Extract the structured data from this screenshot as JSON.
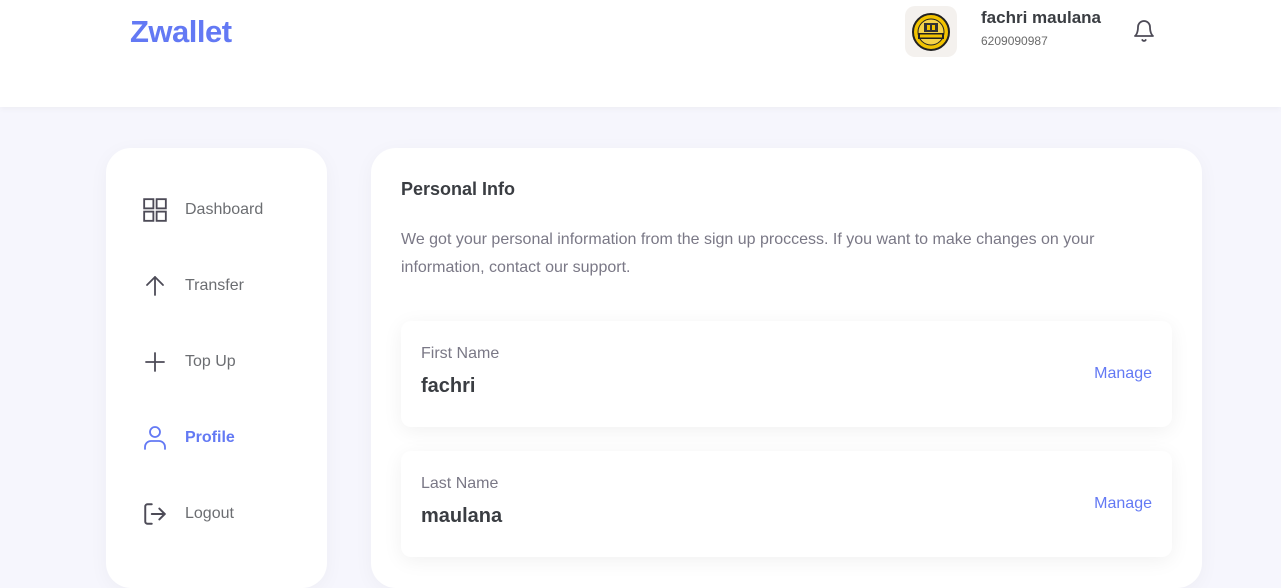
{
  "colors": {
    "accent": "#6379f4",
    "text": "#3a3d42",
    "muted": "#7a7886",
    "background": "#f6f6fd"
  },
  "header": {
    "brand": "Zwallet",
    "user": {
      "name": "fachri maulana",
      "phone": "6209090987"
    },
    "icons": {
      "avatar": "avatar-image",
      "notification": "bell-icon"
    }
  },
  "sidebar": {
    "items": [
      {
        "label": "Dashboard",
        "icon": "grid-icon",
        "active": false
      },
      {
        "label": "Transfer",
        "icon": "arrow-up-icon",
        "active": false
      },
      {
        "label": "Top Up",
        "icon": "plus-icon",
        "active": false
      },
      {
        "label": "Profile",
        "icon": "user-icon",
        "active": true
      },
      {
        "label": "Logout",
        "icon": "logout-icon",
        "active": false
      }
    ]
  },
  "main": {
    "title": "Personal Info",
    "description": "We got your personal information from the sign up proccess. If you want to make changes on your information, contact our support.",
    "fields": [
      {
        "label": "First Name",
        "value": "fachri",
        "action": "Manage"
      },
      {
        "label": "Last Name",
        "value": "maulana",
        "action": "Manage"
      }
    ]
  }
}
